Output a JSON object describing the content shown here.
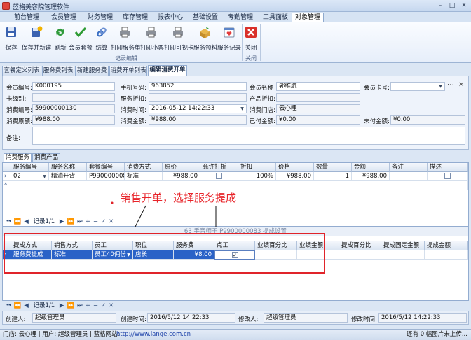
{
  "app": {
    "title": "蓝格美容院管理软件"
  },
  "window": {
    "minimize": "–",
    "maximize": "□",
    "close": "✕"
  },
  "menu": [
    "前台管理",
    "会员管理",
    "财务管理",
    "库存管理",
    "报表中心",
    "基础设置",
    "考勤管理",
    "工具面板",
    "对象管理"
  ],
  "ribbon": {
    "buttons": [
      "保存",
      "保存并新建",
      "刷新",
      "会员套餐",
      "结算",
      "打印服务单",
      "打印小票",
      "打印可视卡",
      "服务领料",
      "服务记录"
    ],
    "group1": "记录编辑",
    "close_button": "关闭",
    "group2": "关闭"
  },
  "doc_tabs": [
    "套餐定义列表",
    "服务费列表",
    "新建服务费",
    "消费开单列表",
    "编辑消费开单"
  ],
  "form": {
    "member_no_label": "会员编号:",
    "member_no": "K000195",
    "phone_label": "手机号码:",
    "phone": "963852",
    "name_label": "会员名称",
    "name": "郭维航",
    "card_label": "会员卡号:",
    "card": "",
    "card_level_label": "卡级别:",
    "card_level": "",
    "service_discount_label": "服务折扣:",
    "service_discount": "",
    "product_discount_label": "产品折扣:",
    "product_discount": "",
    "consume_no_label": "消费编号:",
    "consume_no": "59900000130",
    "consume_time_label": "消费时间:",
    "consume_time": "2016-05-12 14:22:33",
    "store_label": "消费门店:",
    "store": "云心哩",
    "original_amount_label": "消费原额:",
    "original_amount": "¥988.00",
    "consume_amount_label": "消费金额:",
    "consume_amount": "¥988.00",
    "paid_label": "已付金额:",
    "paid": "¥0.00",
    "unpaid_label": "未付金额:",
    "unpaid": "¥0.00",
    "remark_label": "备注:",
    "remark": ""
  },
  "sub_tabs": [
    "消费服务",
    "消费产品"
  ],
  "grid1": {
    "headers": [
      "服务编号",
      "服务名称",
      "套餐编号",
      "消费方式",
      "原价",
      "允许打折",
      "折扣",
      "价格",
      "数量",
      "金额",
      "备注",
      "描述"
    ],
    "row": {
      "code": "02",
      "name": "精油开背",
      "package": "P9900000083",
      "method": "标准",
      "price": "¥988.00",
      "discount": "100%",
      "final_price": "¥988.00",
      "qty": "1",
      "amount": "¥988.00"
    },
    "nav_record": "记录1/1"
  },
  "annotation": "销售开单，选择服务提成",
  "grid2": {
    "title": "63 手音师子  P9900000083  提成设置",
    "headers": [
      "提成方式",
      "销售方式",
      "员工",
      "职位",
      "服务费",
      "点工",
      "业绩百分比",
      "业绩金额",
      "提成百分比",
      "提成固定金额",
      "提成金额"
    ],
    "row": {
      "method": "服务费提成",
      "sale": "标准",
      "employee": "员工40佣份",
      "position": "店长",
      "fee": "¥8.00",
      "point": "✓"
    },
    "nav_record": "记录1/1"
  },
  "footer": {
    "creator_label": "创建人:",
    "creator": "超级管理员",
    "create_time_label": "创建时间:",
    "create_time": "2016/5/12 14:22:33",
    "modifier_label": "修改人:",
    "modifier": "超级管理员",
    "modify_time_label": "修改时间:",
    "modify_time": "2016/5/12 14:22:33"
  },
  "status": {
    "text": "门店: 云心哩 | 用户: 超级管理员 | 蓝格网站:",
    "url": "http://www.lange.com.cn",
    "right": "还有 0 幅图片未上传..."
  },
  "colors": {
    "accent": "#e0242a",
    "selection": "#2a62c7"
  }
}
